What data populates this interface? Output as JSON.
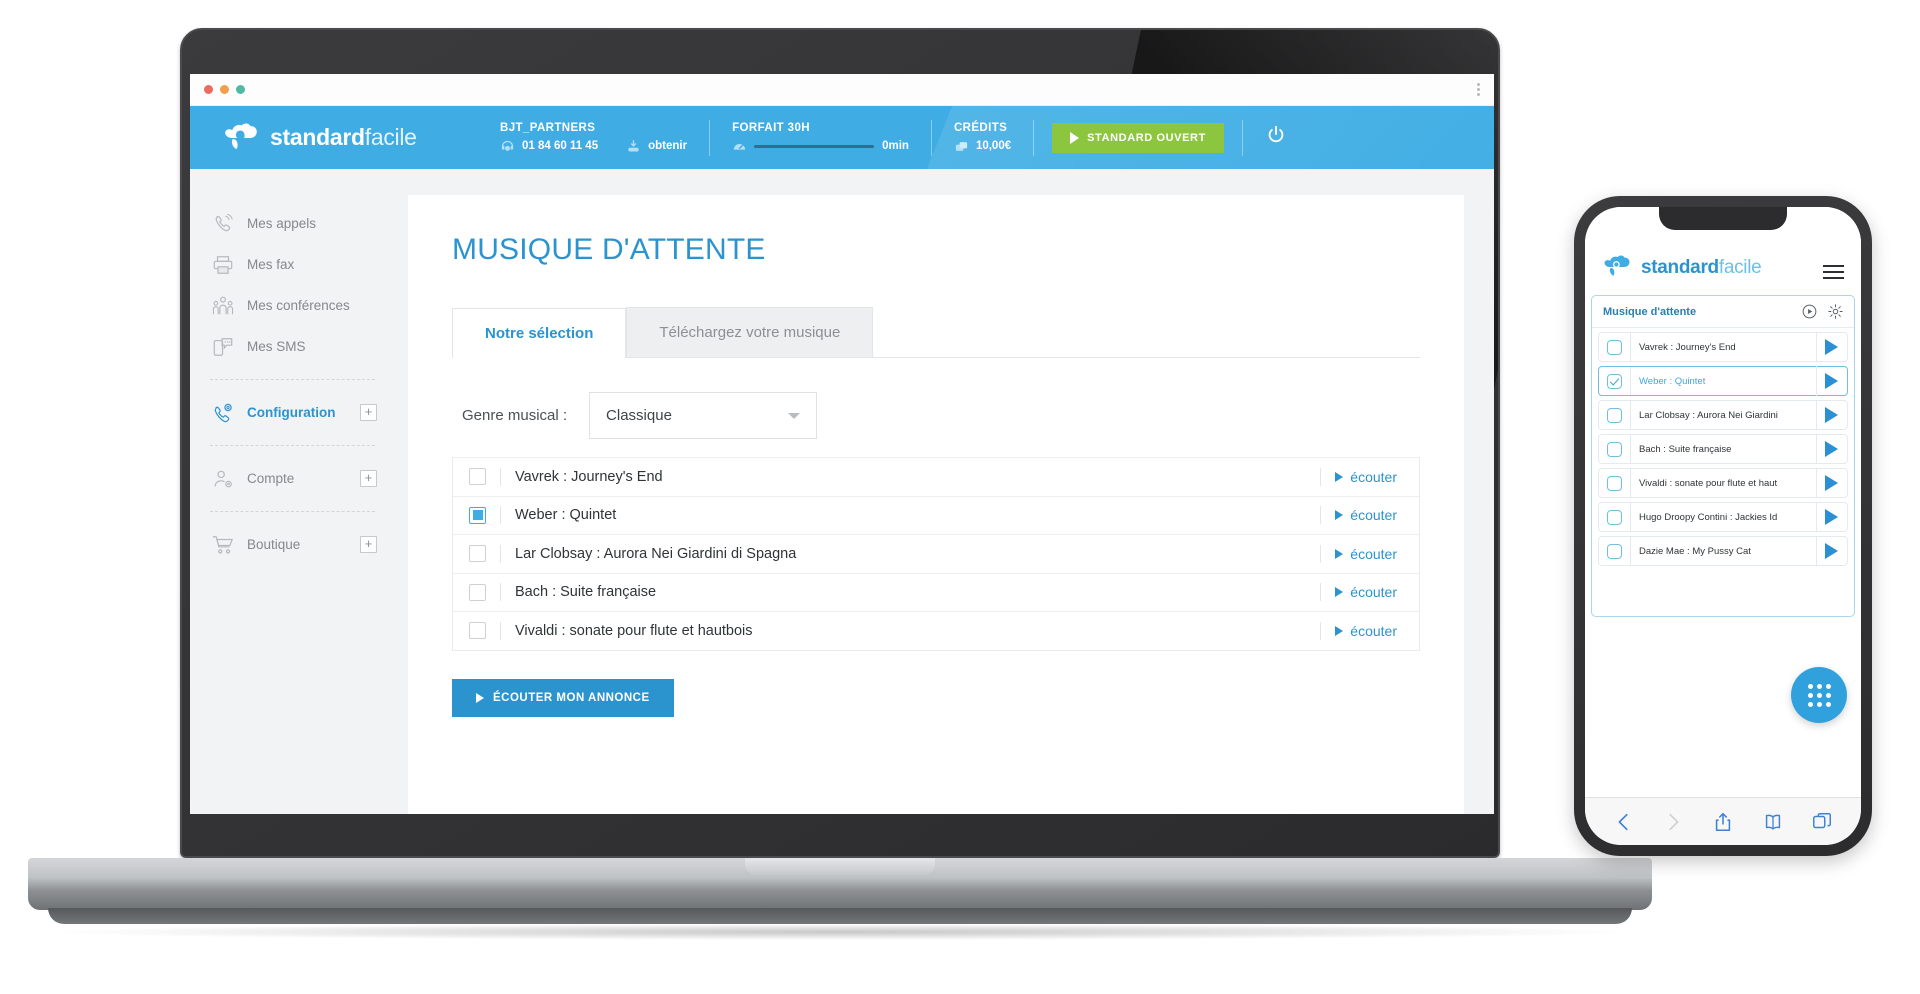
{
  "browser": {
    "dots": [
      "close-red",
      "minimize-orange",
      "maximize-green"
    ],
    "menu_icon": "kebab-menu-icon"
  },
  "header": {
    "brand_bold": "standard",
    "brand_light": "facile",
    "account": {
      "label": "BJT_PARTNERS",
      "phone": "01 84 60 11 45",
      "obtain_label": "obtenir",
      "phone_icon": "phone-icon",
      "obtain_icon": "download-icon"
    },
    "plan": {
      "label": "FORFAIT 30H",
      "value": "0min",
      "icon": "gauge-icon",
      "progress_pct": 0
    },
    "credits": {
      "label": "CRÉDITS",
      "value": "10,00€",
      "icon": "coins-icon"
    },
    "status_button": "STANDARD OUVERT",
    "power_icon": "power-icon"
  },
  "sidebar": {
    "items": [
      {
        "label": "Mes appels",
        "icon": "phone-ring-icon",
        "plus": false,
        "active": false
      },
      {
        "label": "Mes fax",
        "icon": "printer-icon",
        "plus": false,
        "active": false
      },
      {
        "label": "Mes conférences",
        "icon": "group-icon",
        "plus": false,
        "active": false
      },
      {
        "label": "Mes SMS",
        "icon": "sms-icon",
        "plus": false,
        "active": false
      },
      {
        "label": "Configuration",
        "icon": "phone-gear-icon",
        "plus": true,
        "active": true
      },
      {
        "label": "Compte",
        "icon": "user-gear-icon",
        "plus": true,
        "active": false
      },
      {
        "label": "Boutique",
        "icon": "cart-icon",
        "plus": true,
        "active": false
      }
    ],
    "plus_label": "+"
  },
  "main": {
    "title": "MUSIQUE D'ATTENTE",
    "tabs": [
      {
        "label": "Notre sélection",
        "active": true
      },
      {
        "label": "Téléchargez votre musique",
        "active": false
      }
    ],
    "genre_label": "Genre musical :",
    "genre_value": "Classique",
    "genre_options": [
      "Classique"
    ],
    "listen_label": "écouter",
    "tracks": [
      {
        "name": "Vavrek : Journey's End",
        "checked": false
      },
      {
        "name": "Weber : Quintet",
        "checked": true
      },
      {
        "name": "Lar Clobsay : Aurora Nei Giardini di Spagna",
        "checked": false
      },
      {
        "name": "Bach : Suite française",
        "checked": false
      },
      {
        "name": "Vivaldi : sonate pour flute et hautbois",
        "checked": false
      }
    ],
    "announce_button": "ÉCOUTER MON ANNONCE"
  },
  "mobile": {
    "brand_bold": "standard",
    "brand_light": "facile",
    "menu_icon": "hamburger-icon",
    "panel_title": "Musique d'attente",
    "panel_play_icon": "play-circle-icon",
    "panel_settings_icon": "gear-icon",
    "tracks": [
      {
        "name": "Vavrek : Journey's End",
        "checked": false
      },
      {
        "name": "Weber : Quintet",
        "checked": true
      },
      {
        "name": "Lar Clobsay : Aurora Nei Giardini",
        "checked": false
      },
      {
        "name": "Bach : Suite française",
        "checked": false
      },
      {
        "name": "Vivaldi : sonate pour flute et haut",
        "checked": false
      },
      {
        "name": "Hugo Droopy Contini : Jackies Id",
        "checked": false
      },
      {
        "name": "Dazie Mae : My Pussy Cat",
        "checked": false
      }
    ],
    "fab_icon": "dialpad-icon",
    "safari_bar": [
      {
        "icon": "back-arrow-icon",
        "enabled": true
      },
      {
        "icon": "forward-arrow-icon",
        "enabled": false
      },
      {
        "icon": "share-icon",
        "enabled": true
      },
      {
        "icon": "bookmarks-icon",
        "enabled": true
      },
      {
        "icon": "tabs-icon",
        "enabled": true
      }
    ]
  },
  "colors": {
    "brand_blue": "#3fade4",
    "accent_blue": "#2b94cf",
    "green": "#8cc63f",
    "text_dark": "#2f3437",
    "muted": "#84898d"
  }
}
